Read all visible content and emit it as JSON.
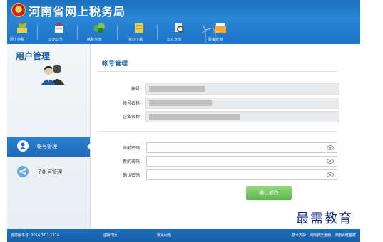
{
  "header": {
    "site_title": "河南省网上税务局",
    "nav": [
      {
        "label": "网上办税",
        "icon": "tax-filing-icon"
      },
      {
        "label": "公示公告",
        "icon": "announcement-icon"
      },
      {
        "label": "纳税咨询",
        "icon": "consult-icon"
      },
      {
        "label": "资料下载",
        "icon": "download-icon"
      },
      {
        "label": "公众查询",
        "icon": "query-icon"
      },
      {
        "label": "政策查询",
        "icon": "policy-folder-icon"
      }
    ]
  },
  "sidebar": {
    "title": "用户管理",
    "items": [
      {
        "label": "帐号管理",
        "active": true
      },
      {
        "label": "子帐号管理",
        "active": false
      }
    ]
  },
  "main": {
    "title": "帐号管理",
    "account_fields": [
      {
        "label": "帐号"
      },
      {
        "label": "帐号名称"
      },
      {
        "label": "企业名称"
      }
    ],
    "password_fields": [
      {
        "label": "当前密码"
      },
      {
        "label": "新的密码"
      },
      {
        "label": "确认密码"
      }
    ],
    "confirm_button": "确认修改"
  },
  "footer": {
    "version": "当前版本号: 2014.37.1.1214",
    "calendar": "征期日历",
    "faq": "常见问题",
    "tech_support": "技术支持：河南航天金穗、河南百旺金赋"
  },
  "watermark": "最需教育",
  "colors": {
    "header_blue": "#2a86d6",
    "sidebar_active": "#2b82d2",
    "confirm_green": "#6cc45a",
    "title_blue": "#1f5fa6"
  }
}
